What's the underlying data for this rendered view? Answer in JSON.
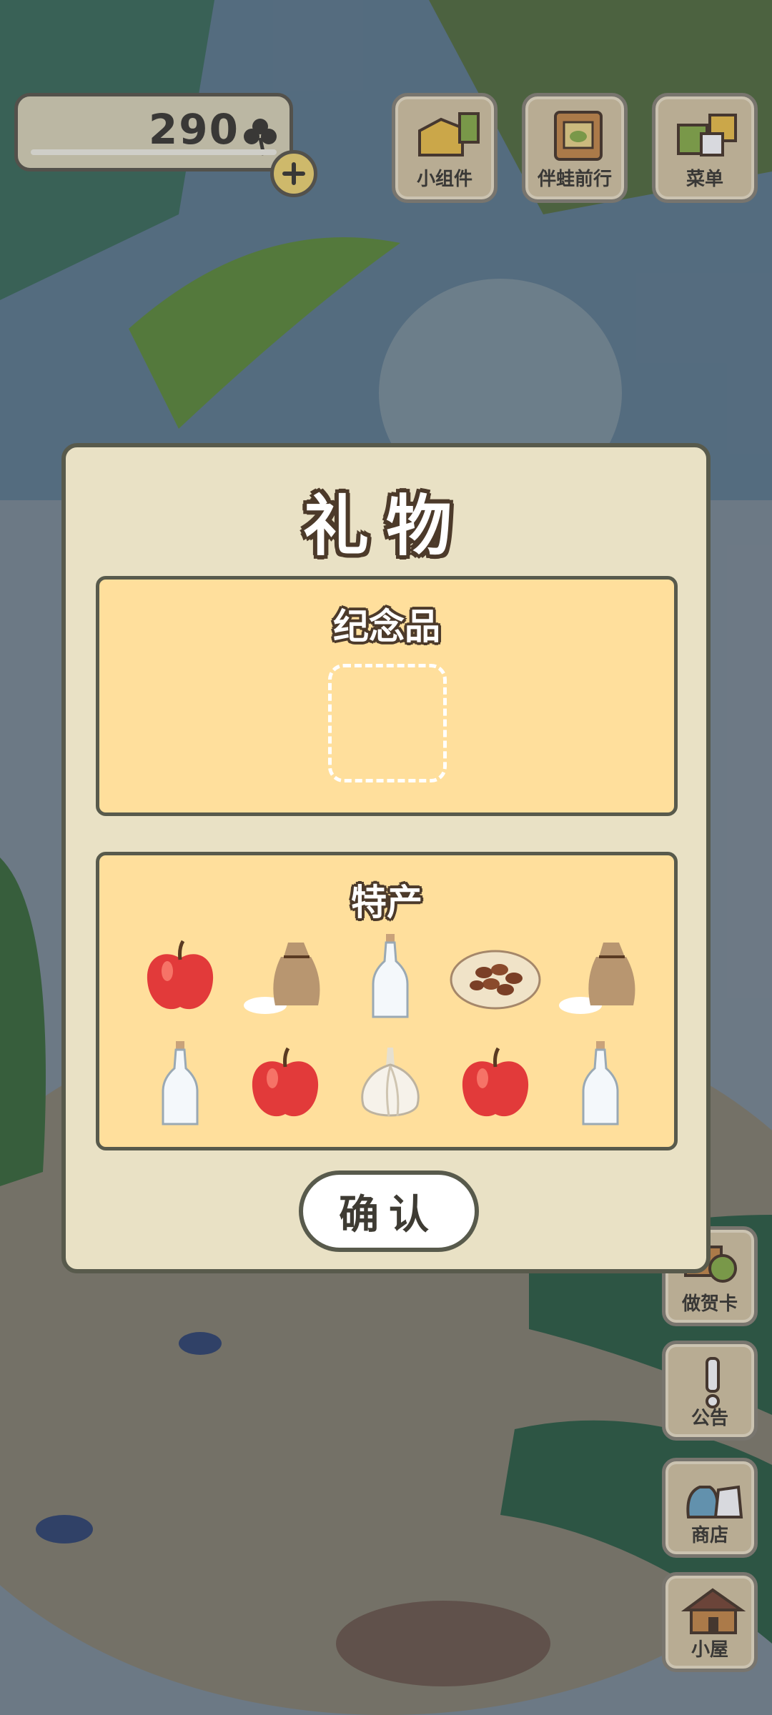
{
  "header": {
    "clover_count": "290",
    "buttons": [
      {
        "label": "小组件",
        "icon": "widget-icon"
      },
      {
        "label": "伴蛙前行",
        "icon": "frog-companion-icon"
      },
      {
        "label": "菜单",
        "icon": "menu-icon"
      }
    ]
  },
  "side_buttons": [
    {
      "label": "做贺卡",
      "icon": "card-icon"
    },
    {
      "label": "公告",
      "icon": "notice-icon"
    },
    {
      "label": "商店",
      "icon": "shop-icon"
    },
    {
      "label": "小屋",
      "icon": "house-icon"
    }
  ],
  "dialog": {
    "title": "礼物",
    "souvenir_title": "纪念品",
    "specialty_title": "特产",
    "specialty_items": [
      "apple",
      "rice-bag",
      "bottle",
      "nuts-plate",
      "rice-bag",
      "bottle",
      "apple",
      "garlic",
      "apple",
      "bottle"
    ],
    "confirm_label": "确认"
  },
  "colors": {
    "panel": "#ffdf9c",
    "dialog": "#e9e1c5",
    "border": "#585a4c"
  }
}
